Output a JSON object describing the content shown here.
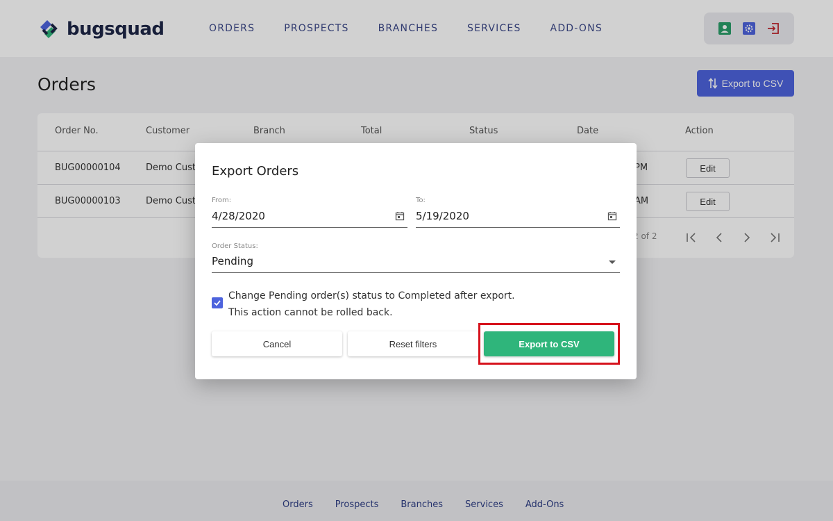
{
  "brand": {
    "name": "bugsquad",
    "primary": "#4d63dd",
    "success": "#2fb57b",
    "danger": "#d6131d",
    "dark": "#1e2647"
  },
  "nav": {
    "items": [
      "ORDERS",
      "PROSPECTS",
      "BRANCHES",
      "SERVICES",
      "ADD-ONS"
    ]
  },
  "header_actions": {
    "icons": [
      "user-icon",
      "gear-icon",
      "logout-icon"
    ]
  },
  "page": {
    "title": "Orders",
    "export_label": "Export to CSV"
  },
  "table": {
    "columns": [
      "Order No.",
      "Customer",
      "Branch",
      "Total",
      "Status",
      "Date",
      "Action"
    ],
    "rows": [
      {
        "order_no": "BUG00000104",
        "customer": "Demo Custo",
        "date_tail": "PM",
        "action": "Edit"
      },
      {
        "order_no": "BUG00000103",
        "customer": "Demo Custo",
        "date_tail": "AM",
        "action": "Edit"
      }
    ],
    "pagination": {
      "text": "2 of 2"
    }
  },
  "modal": {
    "title": "Export Orders",
    "from_label": "From:",
    "from_value": "4/28/2020",
    "to_label": "To:",
    "to_value": "5/19/2020",
    "status_label": "Order Status:",
    "status_value": "Pending",
    "checkbox_line1": "Change Pending order(s) status to Completed after export.",
    "checkbox_line2": "This action cannot be rolled back.",
    "checked": true,
    "cancel_label": "Cancel",
    "reset_label": "Reset filters",
    "export_label": "Export to CSV"
  },
  "footer": {
    "links": [
      "Orders",
      "Prospects",
      "Branches",
      "Services",
      "Add-Ons"
    ]
  }
}
